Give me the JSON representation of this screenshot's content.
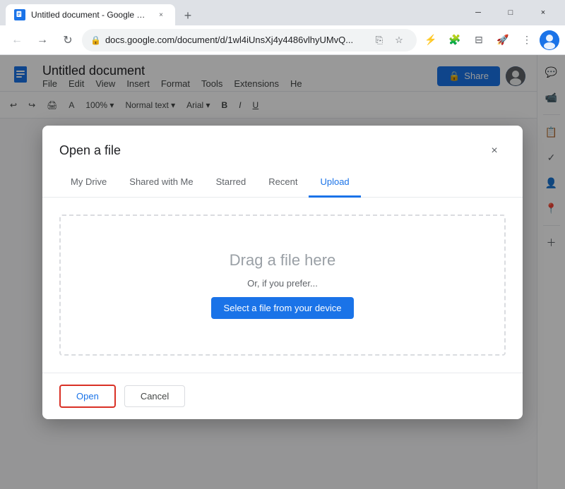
{
  "window": {
    "tab_title": "Untitled document - Google Do...",
    "close_btn": "×",
    "minimize_btn": "─",
    "maximize_btn": "□",
    "new_tab_btn": "+"
  },
  "address_bar": {
    "url": "docs.google.com/document/d/1wl4iUnsXj4y4486vlhyUMvQ...",
    "lock_icon": "🔒"
  },
  "docs": {
    "title": "Untitled document",
    "menu_items": [
      "File",
      "Edit",
      "View",
      "Insert",
      "Format",
      "Tools",
      "Extensions",
      "He"
    ],
    "share_label": "Share",
    "toolbar_items": [
      "↩",
      "↪",
      "🖨",
      "A",
      "100%",
      "▾",
      "Normal text",
      "▾",
      "Arial",
      "▾",
      "│",
      "B",
      "I",
      "U"
    ]
  },
  "dialog": {
    "title": "Open a file",
    "close_icon": "×",
    "tabs": [
      {
        "id": "my-drive",
        "label": "My Drive",
        "active": false
      },
      {
        "id": "shared",
        "label": "Shared with Me",
        "active": false
      },
      {
        "id": "starred",
        "label": "Starred",
        "active": false
      },
      {
        "id": "recent",
        "label": "Recent",
        "active": false
      },
      {
        "id": "upload",
        "label": "Upload",
        "active": true
      }
    ],
    "upload": {
      "main_text": "Drag a file here",
      "sub_text": "Or, if you prefer...",
      "select_btn_label": "Select a file from your device"
    },
    "footer": {
      "open_btn_label": "Open",
      "cancel_btn_label": "Cancel"
    }
  },
  "sidebar": {
    "icons": [
      "☰",
      "💬",
      "⏰",
      "✓",
      "📍",
      "＋"
    ]
  }
}
